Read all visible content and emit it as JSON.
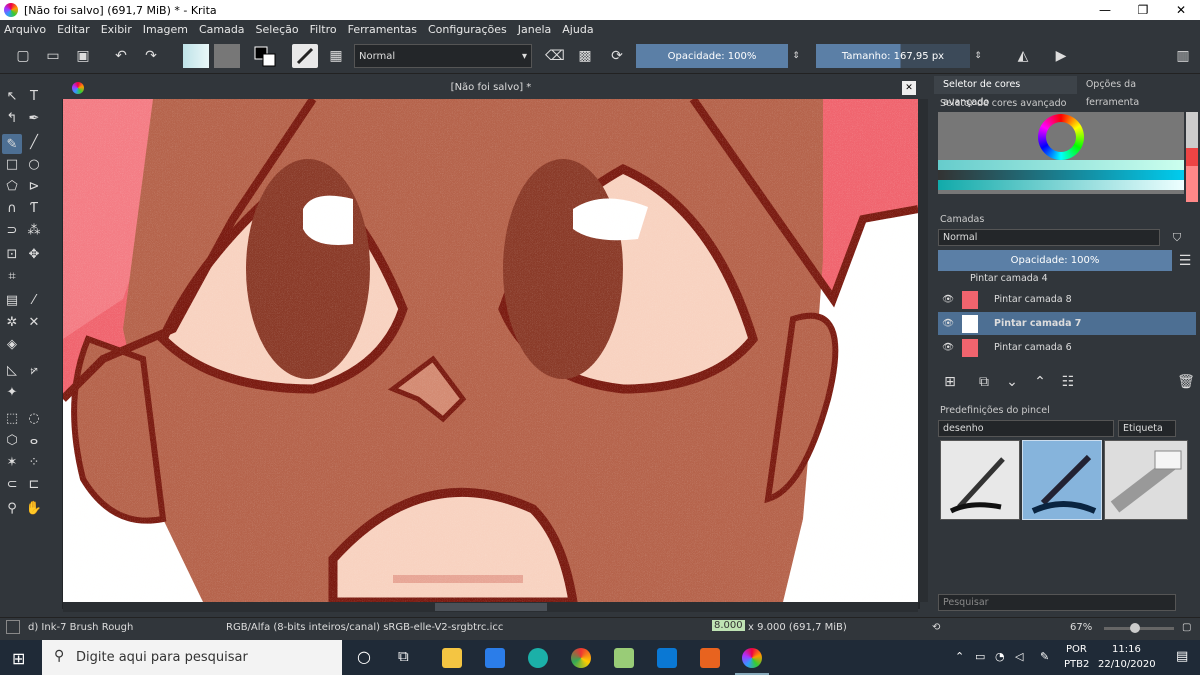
{
  "window": {
    "title": "[Não foi salvo]  (691,7 MiB)  * - Krita",
    "minimize": "—",
    "maximize": "❐",
    "close": "✕"
  },
  "menu": [
    "Arquivo",
    "Editar",
    "Exibir",
    "Imagem",
    "Camada",
    "Seleção",
    "Filtro",
    "Ferramentas",
    "Configurações",
    "Janela",
    "Ajuda"
  ],
  "toolbar": {
    "blend_mode": "Normal",
    "opacity": "Opacidade:  100%",
    "size": "Tamanho:  167,95 px"
  },
  "canvas": {
    "document_title": "[Não foi salvo]  *",
    "close": "✕"
  },
  "dock": {
    "tabs": [
      "Seletor de cores avançado",
      "Opções da ferramenta"
    ],
    "color_selector_title": "Seletor de cores avançado",
    "layers_title": "Camadas",
    "layers_blend": "Normal",
    "layers_opacity": "Opacidade:  100%",
    "layers": [
      {
        "name": "Pintar camada 4",
        "active": false
      },
      {
        "name": "Pintar camada 8",
        "active": false
      },
      {
        "name": "Pintar camada 7",
        "active": true
      },
      {
        "name": "Pintar camada 6",
        "active": false
      }
    ],
    "presets_title": "Predefinições do pincel",
    "presets_filter": "desenho",
    "presets_tag": "Etiqueta",
    "search_placeholder": "Pesquisar"
  },
  "status": {
    "brush": "d) Ink-7 Brush Rough",
    "color_space": "RGB/Alfa (8-bits inteiros/canal)  sRGB-elle-V2-srgbtrc.icc",
    "dimensions_highlight": "8.000",
    "dimensions": "x 9.000 (691,7 MiB)",
    "zoom": "67%"
  },
  "taskbar": {
    "search_placeholder": "Digite aqui para pesquisar",
    "lang": "POR",
    "layout": "PTB2",
    "time": "11:16",
    "date": "22/10/2020"
  },
  "colors": {
    "accent": "#5b7fa6",
    "skin": "#b5634b",
    "hair": "#f0646e",
    "outline": "#7a1a10"
  }
}
